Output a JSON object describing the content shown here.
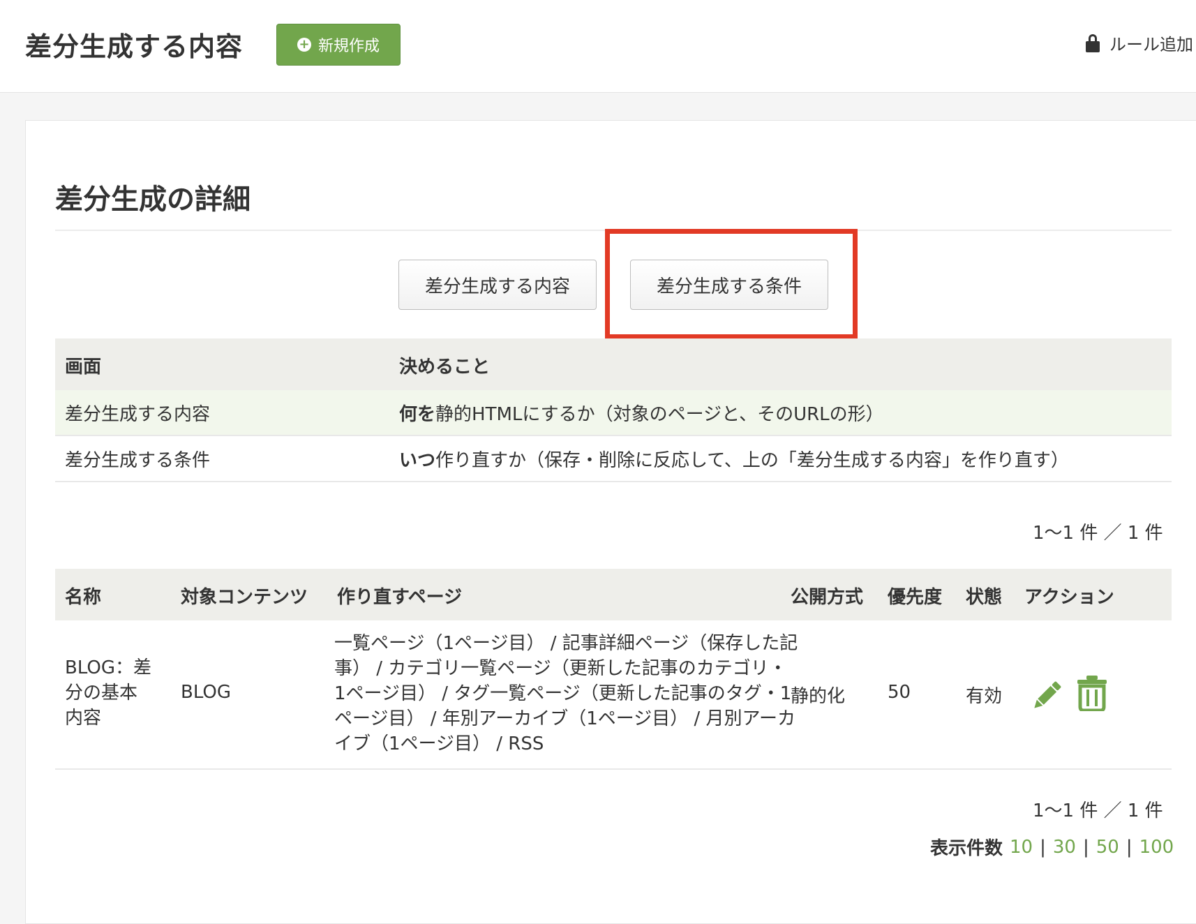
{
  "header": {
    "title": "差分生成する内容",
    "new_button": "新規作成",
    "rule_link": "ルール追加"
  },
  "section": {
    "title": "差分生成の詳細",
    "tabs": [
      {
        "label": "差分生成する内容"
      },
      {
        "label": "差分生成する条件"
      }
    ]
  },
  "info_table": {
    "headers": [
      "画面",
      "決めること"
    ],
    "rows": [
      {
        "screen": "差分生成する内容",
        "bold": "何を",
        "rest": "静的HTMLにするか（対象のページと、そのURLの形）"
      },
      {
        "screen": "差分生成する条件",
        "bold": "いつ",
        "rest": "作り直すか（保存・削除に反応して、上の「差分生成する内容」を作り直す）"
      }
    ]
  },
  "result_count_top": "1〜1 件 ／ 1 件",
  "result_count_bottom": "1〜1 件 ／ 1 件",
  "list_table": {
    "headers": [
      "名称",
      "対象コンテンツ",
      "作り直すページ",
      "公開方式",
      "優先度",
      "状態",
      "アクション"
    ],
    "rows": [
      {
        "name_lines": [
          "BLOG：差",
          "分の基本",
          "内容"
        ],
        "content": "BLOG",
        "pages": "一覧ページ（1ページ目） / 記事詳細ページ（保存した記事） / カテゴリ一覧ページ（更新した記事のカテゴリ・1ページ目） / タグ一覧ページ（更新した記事のタグ・1ページ目） / 年別アーカイブ（1ページ目） / 月別アーカイブ（1ページ目） / RSS",
        "method": "静的化",
        "priority": "50",
        "status": "有効",
        "actions": [
          "pencil-icon",
          "trash-icon"
        ]
      }
    ]
  },
  "per_page": {
    "label": "表示件数",
    "options": [
      "10",
      "30",
      "50",
      "100"
    ]
  },
  "colors": {
    "accent_green": "#72a64c",
    "highlight_red": "#e23a25",
    "header_bg": "#eeeeea",
    "row_highlight": "#f2f7ec"
  }
}
